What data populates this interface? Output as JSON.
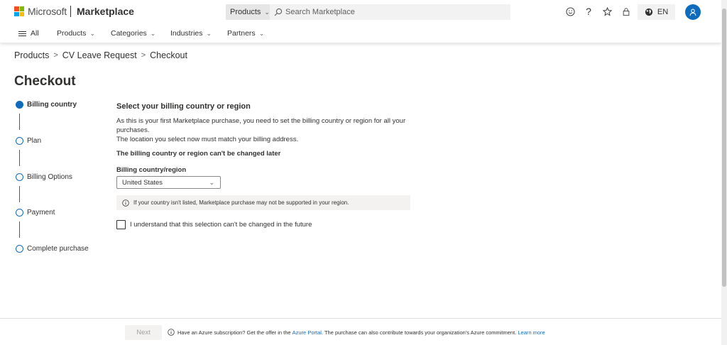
{
  "header": {
    "brand": "Microsoft",
    "product": "Marketplace",
    "search_scope": "Products",
    "search_placeholder": "Search Marketplace",
    "language": "EN",
    "icons": [
      "smiley-icon",
      "help-icon",
      "star-icon",
      "lock-icon",
      "globe-icon",
      "user-icon"
    ]
  },
  "nav": {
    "all_label": "All",
    "items": [
      {
        "label": "Products"
      },
      {
        "label": "Categories"
      },
      {
        "label": "Industries"
      },
      {
        "label": "Partners"
      }
    ]
  },
  "breadcrumb": [
    "Products",
    "CV Leave Request",
    "Checkout"
  ],
  "page_title": "Checkout",
  "steps": [
    {
      "label": "Billing country",
      "active": true
    },
    {
      "label": "Plan",
      "active": false
    },
    {
      "label": "Billing Options",
      "active": false
    },
    {
      "label": "Payment",
      "active": false
    },
    {
      "label": "Complete purchase",
      "active": false
    }
  ],
  "form": {
    "heading": "Select your billing country or region",
    "description_line1": "As this is your first Marketplace purchase, you need to set the billing country or region for all your",
    "description_line2": "purchases.",
    "description_line3": "The location you select now must match your billing address.",
    "warning": "The billing country or region can't be changed later",
    "field_label": "Billing country/region",
    "selected_country": "United States",
    "info_message": "If your country isn't listed, Marketplace purchase may not be supported in your region.",
    "checkbox_label": "I understand that this selection can't be changed in the future",
    "checkbox_checked": false
  },
  "footer": {
    "next_label": "Next",
    "note_prefix": "Have an Azure subscription? Get the offer in the",
    "portal_link": "Azure Portal",
    "note_suffix": ". The purchase can also contribute towards your organization's Azure commitment.",
    "learn_more": "Learn more"
  },
  "colors": {
    "accent": "#0f6cbd",
    "logo_red": "#f25022",
    "logo_green": "#7fba00",
    "logo_blue": "#00a4ef",
    "logo_yellow": "#ffb900"
  }
}
